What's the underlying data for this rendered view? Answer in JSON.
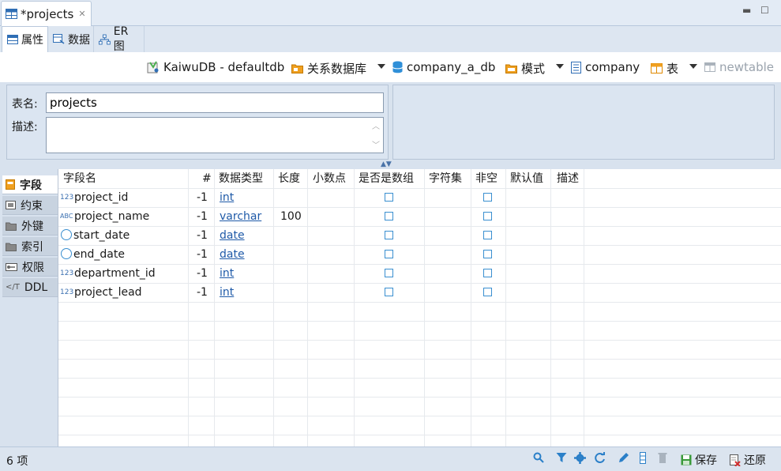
{
  "editor_tab": {
    "title": "*projects"
  },
  "subtabs": [
    {
      "label": "属性"
    },
    {
      "label": "数据"
    },
    {
      "label": "ER 图"
    }
  ],
  "breadcrumb": {
    "connection": "KaiwuDB - defaultdb",
    "db_type": "关系数据库",
    "database": "company_a_db",
    "schema_kind": "模式",
    "schema": "company",
    "object_kind": "表",
    "object": "newtable"
  },
  "props": {
    "name_label": "表名:",
    "name_value": "projects",
    "desc_label": "描述:"
  },
  "vtabs": [
    {
      "label": "字段"
    },
    {
      "label": "约束"
    },
    {
      "label": "外键"
    },
    {
      "label": "索引"
    },
    {
      "label": "权限"
    },
    {
      "label": "DDL"
    }
  ],
  "columns": [
    "字段名",
    "#",
    "数据类型",
    "长度",
    "小数点",
    "是否是数组",
    "字符集",
    "非空",
    "默认值",
    "描述"
  ],
  "rows": [
    {
      "icon": "123",
      "name": "project_id",
      "num": "-1",
      "type": "int",
      "length": ""
    },
    {
      "icon": "ABC",
      "name": "project_name",
      "num": "-1",
      "type": "varchar",
      "length": "100"
    },
    {
      "icon": "clock",
      "name": "start_date",
      "num": "-1",
      "type": "date",
      "length": ""
    },
    {
      "icon": "clock",
      "name": "end_date",
      "num": "-1",
      "type": "date",
      "length": ""
    },
    {
      "icon": "123",
      "name": "department_id",
      "num": "-1",
      "type": "int",
      "length": ""
    },
    {
      "icon": "123",
      "name": "project_lead",
      "num": "-1",
      "type": "int",
      "length": ""
    }
  ],
  "status": {
    "count": "6 项",
    "save": "保存",
    "revert": "还原"
  },
  "colors": {
    "accent": "#1f5aa8",
    "panel": "#d8e2ee",
    "checkbox": "#3a8fd0"
  }
}
